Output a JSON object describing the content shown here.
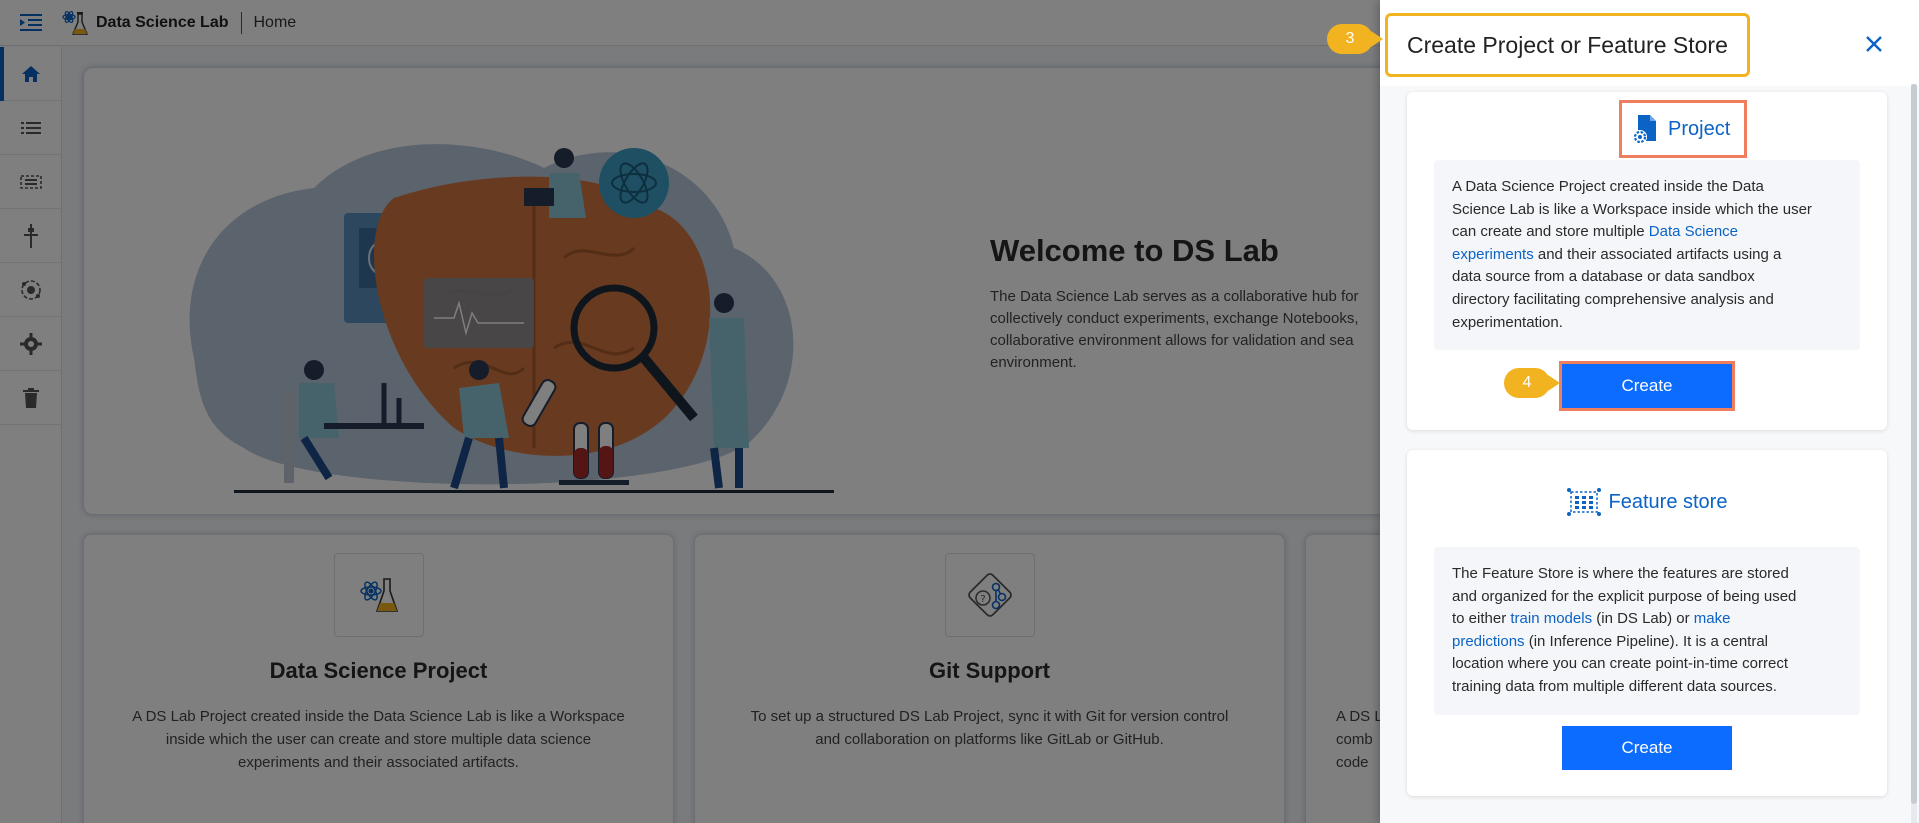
{
  "topbar": {
    "app_title": "Data Science Lab",
    "breadcrumb": "Home"
  },
  "rail": {
    "items": [
      {
        "icon": "home-icon",
        "active": true
      },
      {
        "icon": "list-icon",
        "active": false
      },
      {
        "icon": "feature-store-icon",
        "active": false
      },
      {
        "icon": "plus-pin-icon",
        "active": false
      },
      {
        "icon": "model-icon",
        "active": false
      },
      {
        "icon": "gear-icon",
        "active": false
      },
      {
        "icon": "trash-icon",
        "active": false
      }
    ]
  },
  "hero": {
    "title": "Welcome to DS Lab",
    "desc_lines": [
      "The Data Science Lab serves as a collaborative hub for",
      "collectively conduct experiments, exchange Notebooks,",
      "collaborative environment allows for validation and sea",
      "environment."
    ]
  },
  "cards": [
    {
      "title": "Data Science Project",
      "icon": "atom-flask-icon",
      "desc_lines": [
        "A DS Lab Project created inside the Data Science Lab is like a Workspace",
        "inside which the user can create and store multiple data science",
        "experiments and their associated artifacts."
      ]
    },
    {
      "title": "Git Support",
      "icon": "git-network-icon",
      "desc_lines": [
        "To set up a structured DS Lab Project, sync it with Git for version control",
        "and collaboration on platforms like GitLab or GitHub."
      ]
    },
    {
      "title": "",
      "icon": "",
      "desc_lines": [
        "A DS L",
        "comb",
        "code"
      ]
    }
  ],
  "drawer": {
    "title": "Create Project or Feature Store",
    "step_title": "3",
    "step_create": "4",
    "project": {
      "heading": "Project",
      "body": [
        [
          {
            "t": "A Data Science Project created inside the Data"
          }
        ],
        [
          {
            "t": "Science Lab is like a Workspace inside which the user"
          }
        ],
        [
          {
            "t": "can create and store multiple "
          },
          {
            "t": "Data Science",
            "link": true
          }
        ],
        [
          {
            "t": "experiments",
            "link": true
          },
          {
            "t": " and their associated artifacts using a"
          }
        ],
        [
          {
            "t": "data source from a database or data sandbox"
          }
        ],
        [
          {
            "t": "directory facilitating comprehensive analysis and"
          }
        ],
        [
          {
            "t": "experimentation."
          }
        ]
      ],
      "button": "Create"
    },
    "feature_store": {
      "heading": "Feature store",
      "body": [
        [
          {
            "t": "The Feature Store is where the features are stored"
          }
        ],
        [
          {
            "t": "and organized for the explicit purpose of being used"
          }
        ],
        [
          {
            "t": "to either "
          },
          {
            "t": "train models",
            "link": true
          },
          {
            "t": " (in DS Lab) or "
          },
          {
            "t": "make",
            "link": true
          }
        ],
        [
          {
            "t": "predictions",
            "link": true
          },
          {
            "t": " (in Inference Pipeline). It is a central"
          }
        ],
        [
          {
            "t": "location where you can create point-in-time correct"
          }
        ],
        [
          {
            "t": "training data from multiple different data sources."
          }
        ]
      ],
      "button": "Create"
    }
  },
  "colors": {
    "accent": "#0b63c5",
    "button": "#0b6cff",
    "step_badge": "#f2b321",
    "highlight_box": "#ee7e5d"
  }
}
